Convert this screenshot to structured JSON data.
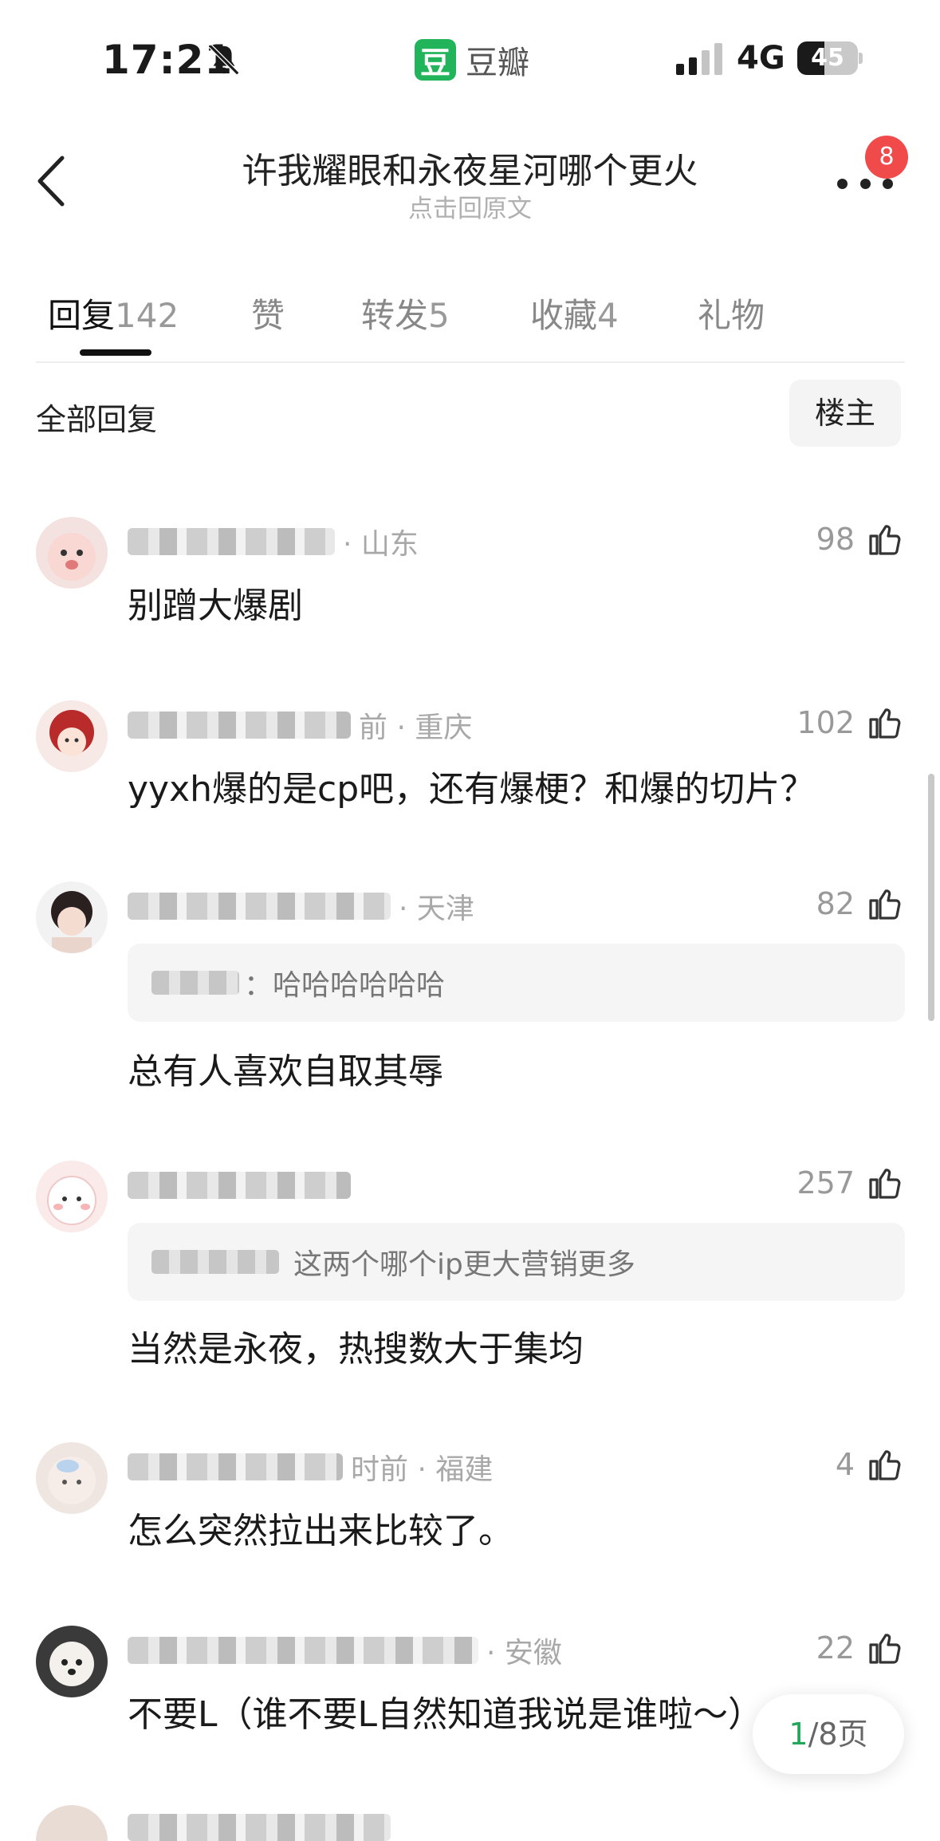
{
  "status_bar": {
    "time": "17:21",
    "app_logo": "豆",
    "app_name": "豆瓣",
    "network": "4G",
    "battery_percent": "45",
    "battery_level": 0.45
  },
  "nav": {
    "title": "许我耀眼和永夜星河哪个更火",
    "subtitle": "点击回原文",
    "notification_count": "8"
  },
  "tabs": [
    {
      "label": "回复",
      "count": "142",
      "active": true
    },
    {
      "label": "赞",
      "count": ""
    },
    {
      "label": "转发",
      "count": "5"
    },
    {
      "label": "收藏",
      "count": "4"
    },
    {
      "label": "礼物",
      "count": ""
    }
  ],
  "filter": {
    "label": "全部回复",
    "op_button": "楼主"
  },
  "comments": [
    {
      "meta": "· 山东",
      "likes": "98",
      "text": "别蹭大爆剧"
    },
    {
      "meta": "前 · 重庆",
      "likes": "102",
      "text": "yyxh爆的是cp吧，还有爆梗？和爆的切片？"
    },
    {
      "meta": "· 天津",
      "likes": "82",
      "quote": "：哈哈哈哈哈哈",
      "text": "总有人喜欢自取其辱"
    },
    {
      "meta": "",
      "likes": "257",
      "quote": "这两个哪个ip更大营销更多",
      "text": "当然是永夜，热搜数大于集均"
    },
    {
      "meta": "时前 · 福建",
      "likes": "4",
      "text": "怎么突然拉出来比较了。"
    },
    {
      "meta": "· 安徽",
      "likes": "22",
      "text": "不要L（谁不要L自然知道我说是谁啦～）"
    }
  ],
  "pager": {
    "current": "1",
    "total_label": "/8页"
  },
  "colors": {
    "brand_green": "#21b45a",
    "badge_red": "#f04a4a",
    "muted_text": "#a8a8a8"
  },
  "icons": [
    "bell-slash-icon",
    "signal-icon",
    "battery-icon",
    "back-chevron-icon",
    "more-dots-icon",
    "thumbs-up-icon"
  ]
}
